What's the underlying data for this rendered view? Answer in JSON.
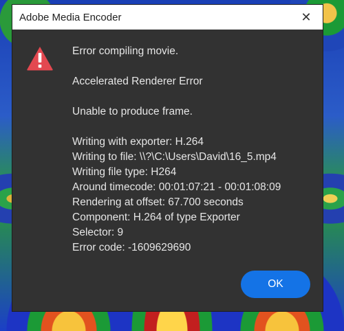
{
  "window": {
    "title": "Adobe Media Encoder",
    "close_glyph": "✕"
  },
  "icon": {
    "name": "warning-icon",
    "color": "#e34850"
  },
  "messages": {
    "line1": "Error compiling movie.",
    "line2": "Accelerated Renderer Error",
    "line3": "Unable to produce frame.",
    "details": [
      "Writing with exporter: H.264",
      "Writing to file: \\\\?\\C:\\Users\\David\\16_5.mp4",
      "Writing file type: H264",
      "Around timecode: 00:01:07:21 - 00:01:08:09",
      "Rendering at offset: 67.700 seconds",
      "Component: H.264 of type Exporter",
      "Selector: 9",
      "Error code: -1609629690"
    ]
  },
  "buttons": {
    "ok_label": "OK"
  },
  "colors": {
    "accent": "#1473e6",
    "dialog_bg": "#323232",
    "text": "#e6e6e6"
  }
}
